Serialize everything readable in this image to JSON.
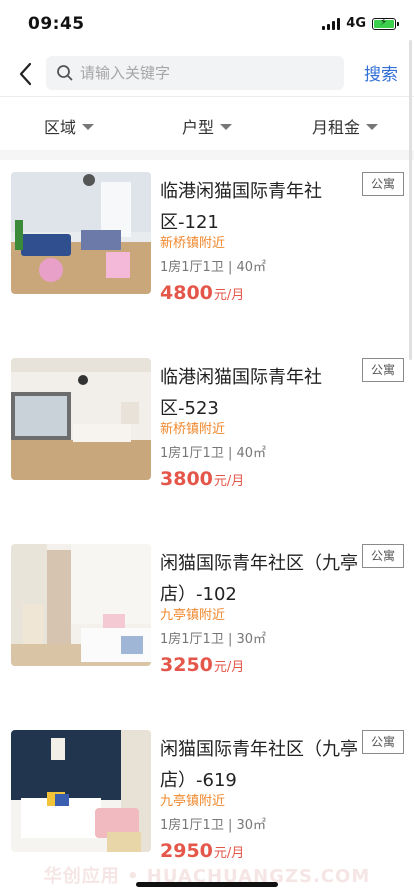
{
  "status_bar": {
    "time": "09:45",
    "network": "4G"
  },
  "search": {
    "placeholder": "请输入关键字",
    "value": "",
    "button_label": "搜索"
  },
  "filters": [
    {
      "label": "区域"
    },
    {
      "label": "户型"
    },
    {
      "label": "月租金"
    }
  ],
  "listings": [
    {
      "title": "临港闲猫国际青年社区-121",
      "tag": "公寓",
      "location": "新桥镇附近",
      "specs": "1房1厅1卫 | 40㎡",
      "price": "4800",
      "price_unit": "元/月"
    },
    {
      "title": "临港闲猫国际青年社区-523",
      "tag": "公寓",
      "location": "新桥镇附近",
      "specs": "1房1厅1卫 | 40㎡",
      "price": "3800",
      "price_unit": "元/月"
    },
    {
      "title": "闲猫国际青年社区（九亭店）-102",
      "tag": "公寓",
      "location": "九亭镇附近",
      "specs": "1房1厅1卫 | 30㎡",
      "price": "3250",
      "price_unit": "元/月"
    },
    {
      "title": "闲猫国际青年社区（九亭店）-619",
      "tag": "公寓",
      "location": "九亭镇附近",
      "specs": "1房1厅1卫 | 30㎡",
      "price": "2950",
      "price_unit": "元/月"
    }
  ],
  "watermark": "华创应用 • HUACHUANGZS.COM",
  "colors": {
    "accent": "#2f6fd6",
    "price": "#e5564a",
    "location": "#f0882d"
  }
}
